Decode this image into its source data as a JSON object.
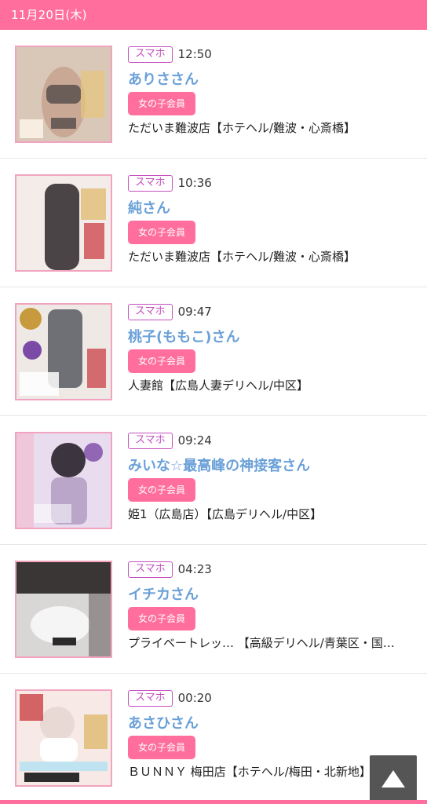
{
  "header": {
    "date": "11月20日(木)"
  },
  "entries": [
    {
      "tag": "スマホ",
      "time": "12:50",
      "name": "ありささん",
      "member": "女の子会員",
      "shop": "ただいま難波店【ホテヘル/難波・心斎橋】"
    },
    {
      "tag": "スマホ",
      "time": "10:36",
      "name": "純さん",
      "member": "女の子会員",
      "shop": "ただいま難波店【ホテヘル/難波・心斎橋】"
    },
    {
      "tag": "スマホ",
      "time": "09:47",
      "name": "桃子(ももこ)さん",
      "member": "女の子会員",
      "shop": "人妻館【広島人妻デリヘル/中区】"
    },
    {
      "tag": "スマホ",
      "time": "09:24",
      "name": "みいな☆最高峰の神接客さん",
      "member": "女の子会員",
      "shop": "姫1（広島店）【広島デリヘル/中区】"
    },
    {
      "tag": "スマホ",
      "time": "04:23",
      "name": "イチカさん",
      "member": "女の子会員",
      "shop": "プライベートレッ… 【高級デリヘル/青葉区・国…"
    },
    {
      "tag": "スマホ",
      "time": "00:20",
      "name": "あさひさん",
      "member": "女の子会員",
      "shop": "ＢＵＮＮＹ 梅田店【ホテヘル/梅田・北新地】"
    }
  ],
  "thumb_colors": [
    {
      "bg": "#d9c7b8",
      "fg": "#6b5e58"
    },
    {
      "bg": "#f3ece8",
      "fg": "#4a4447"
    },
    {
      "bg": "#efe9e6",
      "fg": "#6f6f76"
    },
    {
      "bg": "#e9dcef",
      "fg": "#b9a6c9"
    },
    {
      "bg": "#d9d6d6",
      "fg": "#f5f5f5"
    },
    {
      "bg": "#f6e9e6",
      "fg": "#e8d9d4"
    }
  ],
  "scroll_top_icon": "up-triangle-icon"
}
